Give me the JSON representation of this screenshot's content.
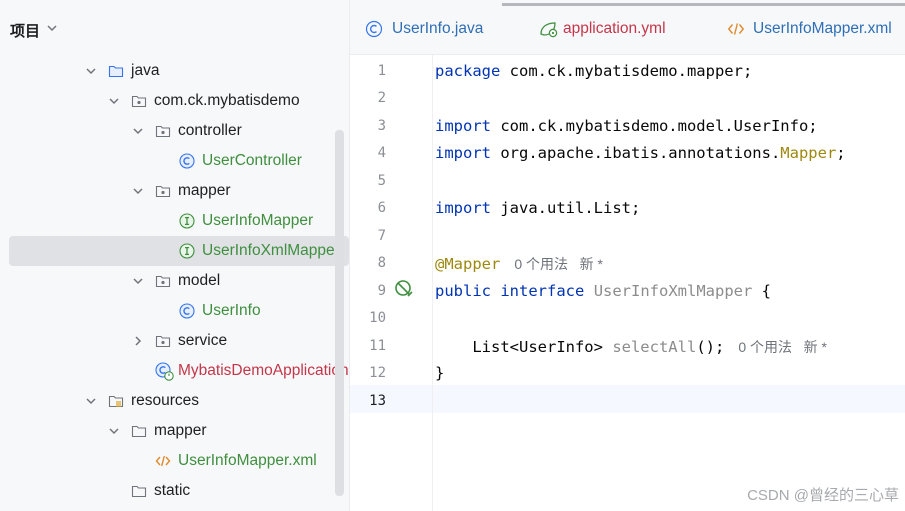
{
  "project": {
    "title": "项目",
    "tree": [
      {
        "label": "java",
        "icon": "folder-icon",
        "expanded": true
      },
      {
        "label": "com.ck.mybatisdemo",
        "icon": "package-icon",
        "expanded": true
      },
      {
        "label": "controller",
        "icon": "package-icon",
        "expanded": true
      },
      {
        "label": "UserController",
        "icon": "class-icon"
      },
      {
        "label": "mapper",
        "icon": "package-icon",
        "expanded": true
      },
      {
        "label": "UserInfoMapper",
        "icon": "interface-icon"
      },
      {
        "label": "UserInfoXmlMapper",
        "icon": "interface-icon",
        "selected": true
      },
      {
        "label": "model",
        "icon": "package-icon",
        "expanded": true
      },
      {
        "label": "UserInfo",
        "icon": "class-icon"
      },
      {
        "label": "service",
        "icon": "package-icon",
        "expanded": false
      },
      {
        "label": "MybatisDemoApplication",
        "icon": "spring-app-icon"
      },
      {
        "label": "resources",
        "icon": "resources-folder-icon",
        "expanded": true
      },
      {
        "label": "mapper",
        "icon": "folder-icon",
        "expanded": true
      },
      {
        "label": "UserInfoMapper.xml",
        "icon": "xml-icon"
      },
      {
        "label": "static",
        "icon": "folder-icon"
      }
    ]
  },
  "tabs": [
    {
      "label": "UserInfo.java",
      "icon": "class-icon",
      "color": "#2f6fb5"
    },
    {
      "label": "application.yml",
      "icon": "spring-config-icon",
      "color": "#c4374a"
    },
    {
      "label": "UserInfoMapper.xml",
      "icon": "xml-icon",
      "color": "#2f6fb5"
    }
  ],
  "editor": {
    "line_numbers": [
      "1",
      "2",
      "3",
      "4",
      "5",
      "6",
      "7",
      "8",
      "9",
      "10",
      "11",
      "12",
      "13"
    ],
    "current_line": "13",
    "lines": {
      "l1_kw": "package",
      "l1_rest": " com.ck.mybatisdemo.mapper;",
      "l3_kw": "import",
      "l3_rest": " com.ck.mybatisdemo.model.UserInfo;",
      "l4_kw": "import",
      "l4_mid": " org.apache.ibatis.annotations.",
      "l4_ann": "Mapper",
      "l4_end": ";",
      "l6_kw": "import",
      "l6_rest": " java.util.List;",
      "l8_ann": "@Mapper",
      "l8_hint": "0 个用法   新 *",
      "l9_kw1": "public",
      "l9_kw2": "interface",
      "l9_name": "UserInfoXmlMapper",
      "l9_brace": " {",
      "l11_type": "    List<UserInfo> ",
      "l11_method": "selectAll",
      "l11_end": "();",
      "l11_hint": "0 个用法   新 *",
      "l12": "}"
    }
  },
  "watermark": "CSDN @曾经的三心草"
}
